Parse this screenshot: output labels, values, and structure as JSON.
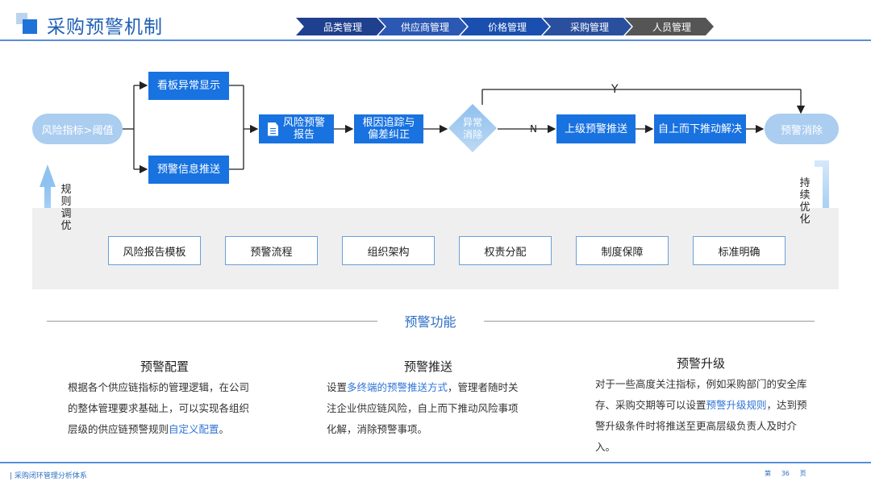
{
  "header": {
    "title": "采购预警机制",
    "tabs": [
      {
        "label": "品类管理",
        "color": "#1f3f8f"
      },
      {
        "label": "供应商管理",
        "color": "#2b58b3"
      },
      {
        "label": "价格管理",
        "color": "#1a4fb0"
      },
      {
        "label": "采购管理",
        "color": "#2a4f9e"
      },
      {
        "label": "人员管理",
        "color": "#555555"
      }
    ]
  },
  "flow": {
    "start": "风险指标>阈值",
    "branch_top": "看板异常显示",
    "branch_bottom": "预警信息推送",
    "report_line1": "风险预警",
    "report_line2": "报告",
    "trace_line1": "根因追踪与",
    "trace_line2": "偏差纠正",
    "decision_line1": "异常",
    "decision_line2": "消除",
    "label_n": "N",
    "label_y": "Y",
    "escalate": "上级预警推送",
    "resolve": "自上而下推动解决",
    "end": "预警消除",
    "left_loop": "规则调优",
    "right_loop": "持续优化"
  },
  "foundation": [
    "风险报告模板",
    "预警流程",
    "组织架构",
    "权责分配",
    "制度保障",
    "标准明确"
  ],
  "features": {
    "section_title": "预警功能",
    "items": [
      {
        "title": "预警配置",
        "body_plain": "根据各个供应链指标的管理逻辑，在公司的整体管理要求基础上，可以实现各组织层级的供应链预警规则",
        "body_highlight": "自定义配置",
        "body_after": "。"
      },
      {
        "title": "预警推送",
        "body_before": "设置",
        "body_highlight": "多终端的预警推送方式",
        "body_after": "，管理者随时关注企业供应链风险，自上而下推动风险事项化解，消除预警事项。"
      },
      {
        "title": "预警升级",
        "body_before": "对于一些高度关注指标，例如采购部门的安全库存、采购交期等可以设置",
        "body_highlight": "预警升级规则",
        "body_after": "，达到预警升级条件时将推送至更高层级负责人及时介入。"
      }
    ]
  },
  "footer": {
    "text": "| 采购闭环管理分析体系",
    "page_prefix": "第",
    "page_number": "36",
    "page_suffix": "页"
  },
  "colors": {
    "primary": "#1872e0",
    "pill": "#aacdf0",
    "highlight": "#2f74d6"
  }
}
